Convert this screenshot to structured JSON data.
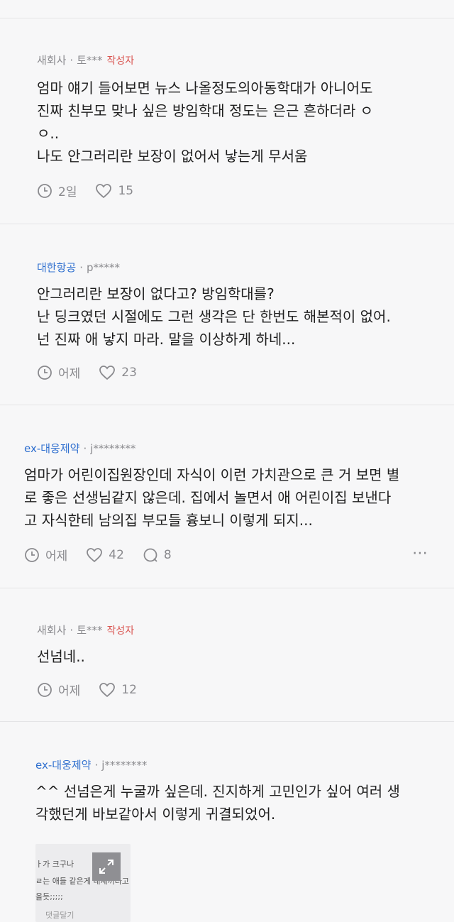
{
  "comments": [
    {
      "company": "새회사",
      "user": "토***",
      "badge": "작성자",
      "lines": [
        "엄마 얘기 들어보면 뉴스 나올정도의아동학대가 아니어도",
        "진짜 친부모 맞나 싶은 방임학대 정도는 은근 흔하더라 ㅇ",
        "ㅇ..",
        "나도 안그러리란 보장이 없어서 낳는게 무서움"
      ],
      "time": "2일",
      "likes": "15"
    },
    {
      "company": "대한항공",
      "user": "p*****",
      "lines": [
        "안그러리란 보장이 없다고? 방임학대를?",
        "난 딩크였던 시절에도 그런 생각은 단 한번도 해본적이 없어.",
        "넌 진짜 애 낳지 마라. 말을 이상하게 하네..."
      ],
      "time": "어제",
      "likes": "23"
    },
    {
      "company": "ex-대웅제약",
      "user": "j********",
      "lines": [
        "엄마가 어린이집원장인데 자식이 이런 가치관으로 큰 거 보면 별",
        "로 좋은 선생님같지 않은데. 집에서 놀면서 애 어린이집 보낸다",
        "고 자식한테 남의집 부모들 흉보니 이렇게 되지..."
      ],
      "time": "어제",
      "likes": "42",
      "replies": "8",
      "more": "⋯"
    },
    {
      "company": "새회사",
      "user": "토***",
      "badge": "작성자",
      "lines": [
        "선넘네.."
      ],
      "time": "어제",
      "likes": "12"
    },
    {
      "company": "ex-대웅제약",
      "user": "j********",
      "lines": [
        "^^ 선넘은게 누굴까 싶은데. 진지하게 고민인가 싶어 여러 생",
        "각했던게 바보같아서 이렇게 귀결되었어."
      ],
      "attachment": {
        "lines": [
          "ㅏ가 크구나",
          "ㄹ는 애들 같은게 내새끼라고",
          "을듯;;;;;",
          "댓글달기"
        ]
      }
    }
  ]
}
